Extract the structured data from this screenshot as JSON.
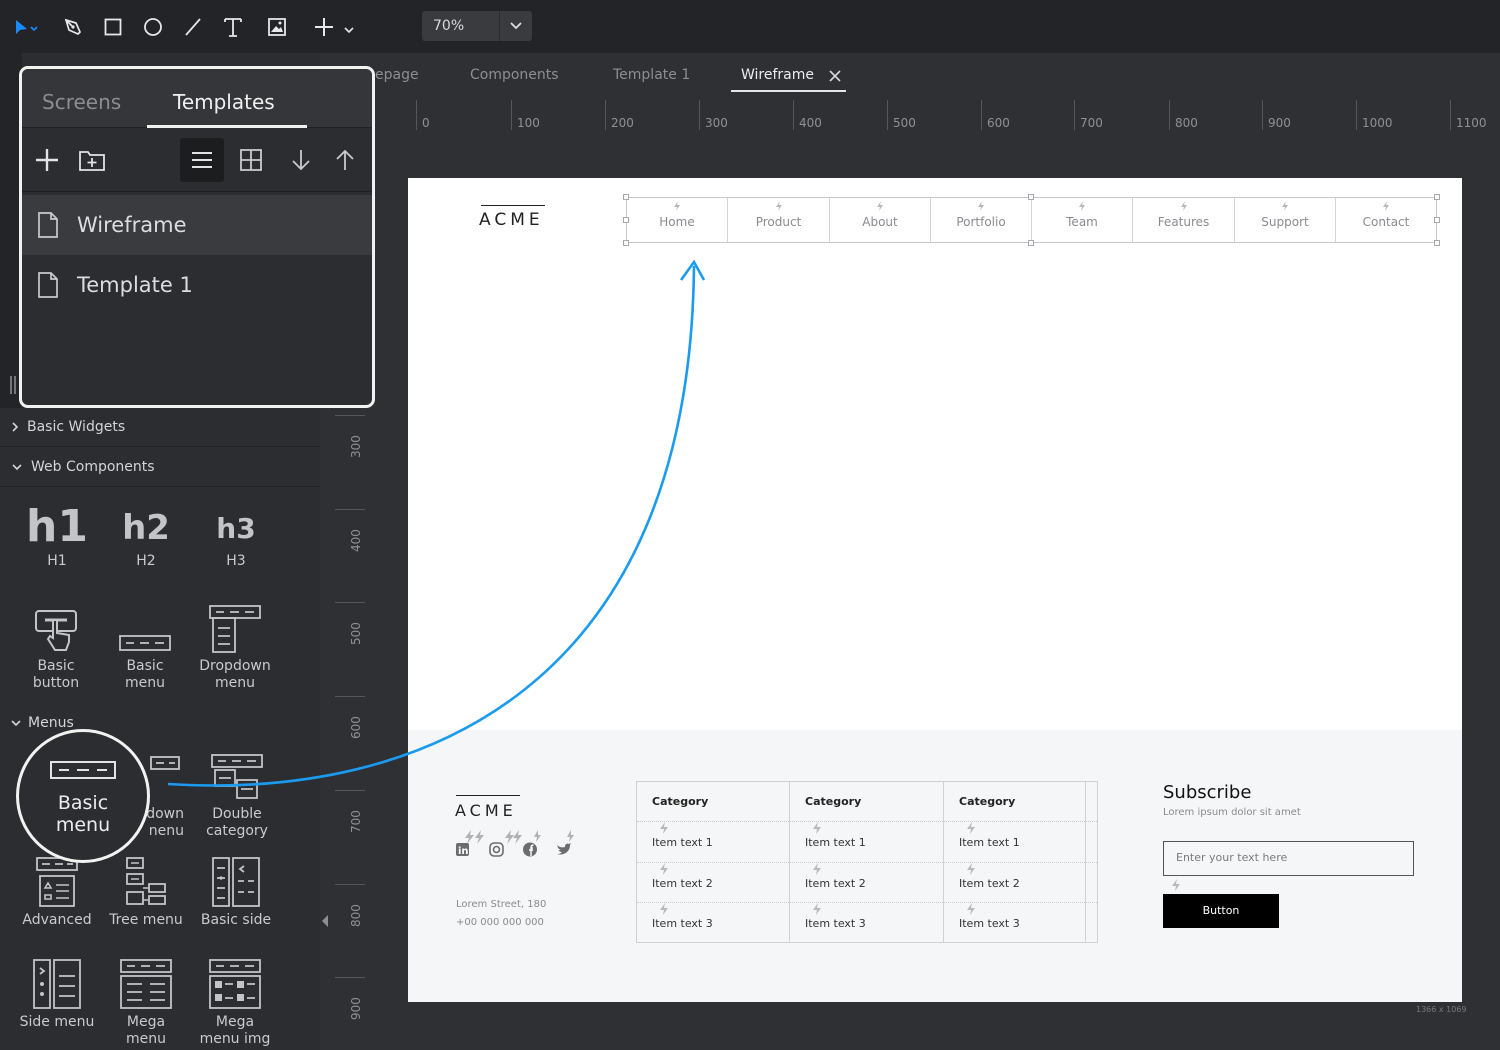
{
  "toolbar": {
    "tools": [
      "select-tool",
      "pen-tool",
      "rectangle-tool",
      "ellipse-tool",
      "line-tool",
      "text-tool",
      "image-tool",
      "add-tool"
    ],
    "zoom": "70%"
  },
  "tabs": [
    {
      "label": "epage",
      "active": false
    },
    {
      "label": "Components",
      "active": false
    },
    {
      "label": "Template 1",
      "active": false
    },
    {
      "label": "Wireframe",
      "active": true
    }
  ],
  "ruler_top": [
    "0",
    "100",
    "200",
    "300",
    "400",
    "500",
    "600",
    "700",
    "800",
    "900",
    "1000",
    "1100"
  ],
  "ruler_left": [
    "300",
    "400",
    "500",
    "600",
    "700",
    "800",
    "900"
  ],
  "popover": {
    "tabs": [
      "Screens",
      "Templates"
    ],
    "active_tab": "Templates",
    "items": [
      {
        "label": "Wireframe",
        "selected": true
      },
      {
        "label": "Template 1",
        "selected": false
      }
    ]
  },
  "left_panel": {
    "sections": [
      "Basic Widgets",
      "Web Components",
      "Menus"
    ],
    "headings": [
      {
        "glyph": "h1",
        "label": "H1"
      },
      {
        "glyph": "h2",
        "label": "H2"
      },
      {
        "glyph": "h3",
        "label": "H3"
      }
    ],
    "web_widgets": [
      {
        "line1": "Basic",
        "line2": "button"
      },
      {
        "line1": "Basic",
        "line2": "menu"
      },
      {
        "line1": "Dropdown",
        "line2": "menu"
      }
    ],
    "menus_row1": [
      {
        "line1": "Basic",
        "line2": "menu"
      },
      {
        "line1": "down",
        "line2": "nenu"
      },
      {
        "line1": "Double",
        "line2": "category"
      }
    ],
    "menus_row2": [
      "Advanced",
      "Tree menu",
      "Basic side"
    ],
    "menus_row3": [
      {
        "line1": "Side menu",
        "line2": ""
      },
      {
        "line1": "Mega",
        "line2": "menu"
      },
      {
        "line1": "Mega",
        "line2": "menu img"
      }
    ]
  },
  "wireframe": {
    "logo": "ACME",
    "nav": [
      "Home",
      "Product",
      "About",
      "Portfolio",
      "Team",
      "Features",
      "Support",
      "Contact"
    ],
    "footer": {
      "logo": "ACME",
      "social": [
        "linkedin-icon",
        "instagram-icon",
        "facebook-icon",
        "twitter-icon"
      ],
      "address": "Lorem Street, 180",
      "phone": "+00 000 000 000",
      "categories": [
        {
          "title": "Category",
          "items": [
            "Item text 1",
            "Item text 2",
            "Item text 3"
          ]
        },
        {
          "title": "Category",
          "items": [
            "Item text 1",
            "Item text 2",
            "Item text 3"
          ]
        },
        {
          "title": "Category",
          "items": [
            "Item text 1",
            "Item text 2",
            "Item text 3"
          ]
        }
      ],
      "subscribe_title": "Subscribe",
      "subscribe_text": "Lorem ipsum dolor sit amet",
      "input_placeholder": "Enter your text here",
      "button": "Button"
    },
    "page_size": "1366 x 1069"
  },
  "colors": {
    "accent": "#1a8cff",
    "arrow": "#1b9bf0",
    "bg_dark": "#232427",
    "panel": "#2c2d30"
  }
}
